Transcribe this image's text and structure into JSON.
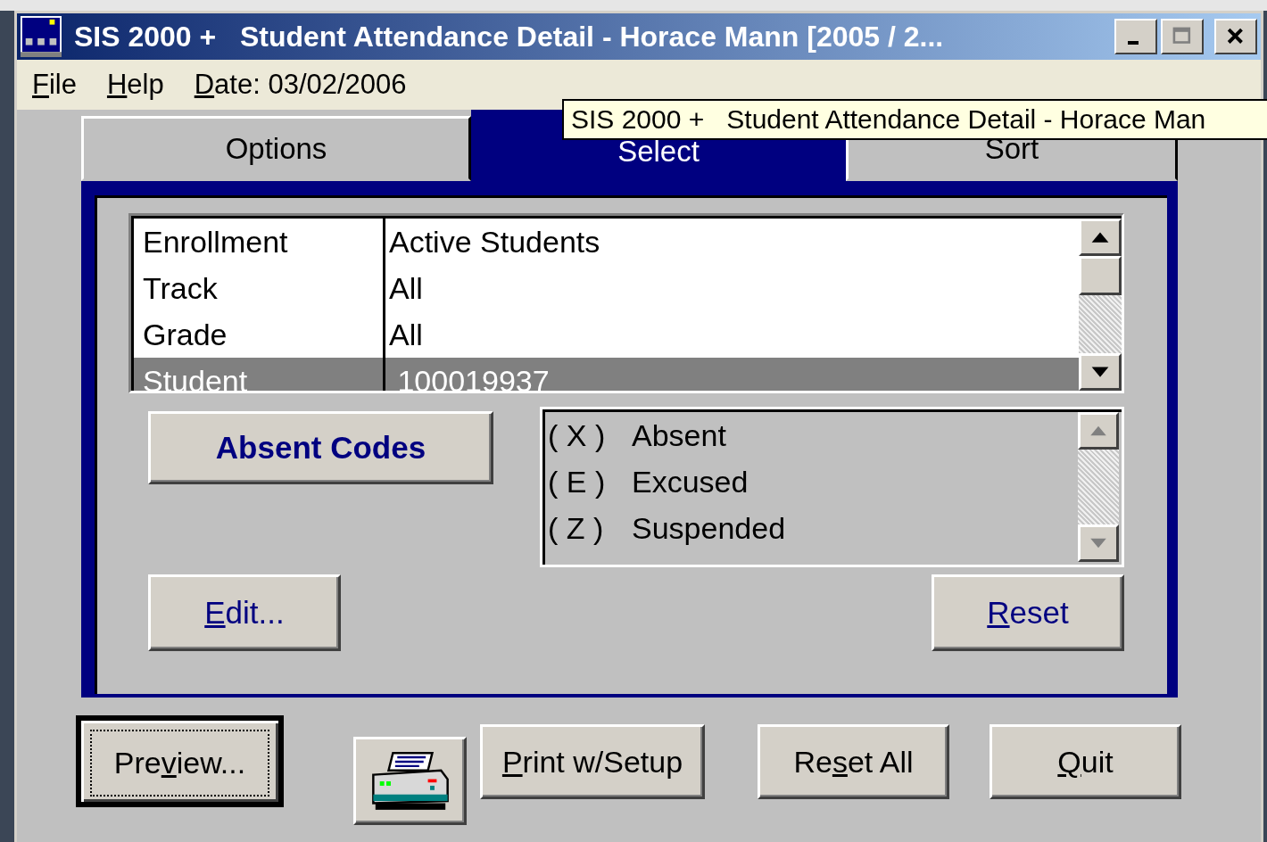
{
  "window": {
    "title": "SIS 2000 +   Student Attendance Detail - Horace Mann [2005 / 2..."
  },
  "menu": [
    {
      "key": "F",
      "post": "ile"
    },
    {
      "key": "H",
      "post": "elp"
    }
  ],
  "date": {
    "key": "D",
    "post": "ate: 03/02/2006"
  },
  "tooltip": "SIS 2000 +   Student Attendance Detail - Horace Man",
  "tabs": [
    {
      "label": "Options",
      "selected": false
    },
    {
      "label": "Select",
      "selected": true
    },
    {
      "label": "Sort",
      "selected": false
    }
  ],
  "criteria": [
    {
      "name": "Enrollment",
      "value": "Active Students",
      "selected": false
    },
    {
      "name": "Track",
      "value": "All",
      "selected": false
    },
    {
      "name": "Grade",
      "value": "All",
      "selected": false
    },
    {
      "name": "Student",
      "value": " 100019937",
      "selected": true
    }
  ],
  "absent_codes_button": "Absent Codes",
  "codes": [
    {
      "code": "( X )",
      "label": "Absent"
    },
    {
      "code": "( E )",
      "label": "Excused"
    },
    {
      "code": "( Z )",
      "label": "Suspended"
    }
  ],
  "edit_button": {
    "key": "E",
    "post": "dit..."
  },
  "reset_button": {
    "key": "R",
    "post": "eset"
  },
  "bottom_buttons": [
    {
      "kind": "default",
      "pre": "Pre",
      "key": "v",
      "post": "iew..."
    },
    {
      "kind": "icon"
    },
    {
      "kind": "plain",
      "key": "P",
      "post": "rint w/Setup"
    },
    {
      "kind": "plain",
      "pre": "Re",
      "key": "s",
      "post": "et All"
    },
    {
      "kind": "plain",
      "key": "Q",
      "post": "uit"
    }
  ]
}
